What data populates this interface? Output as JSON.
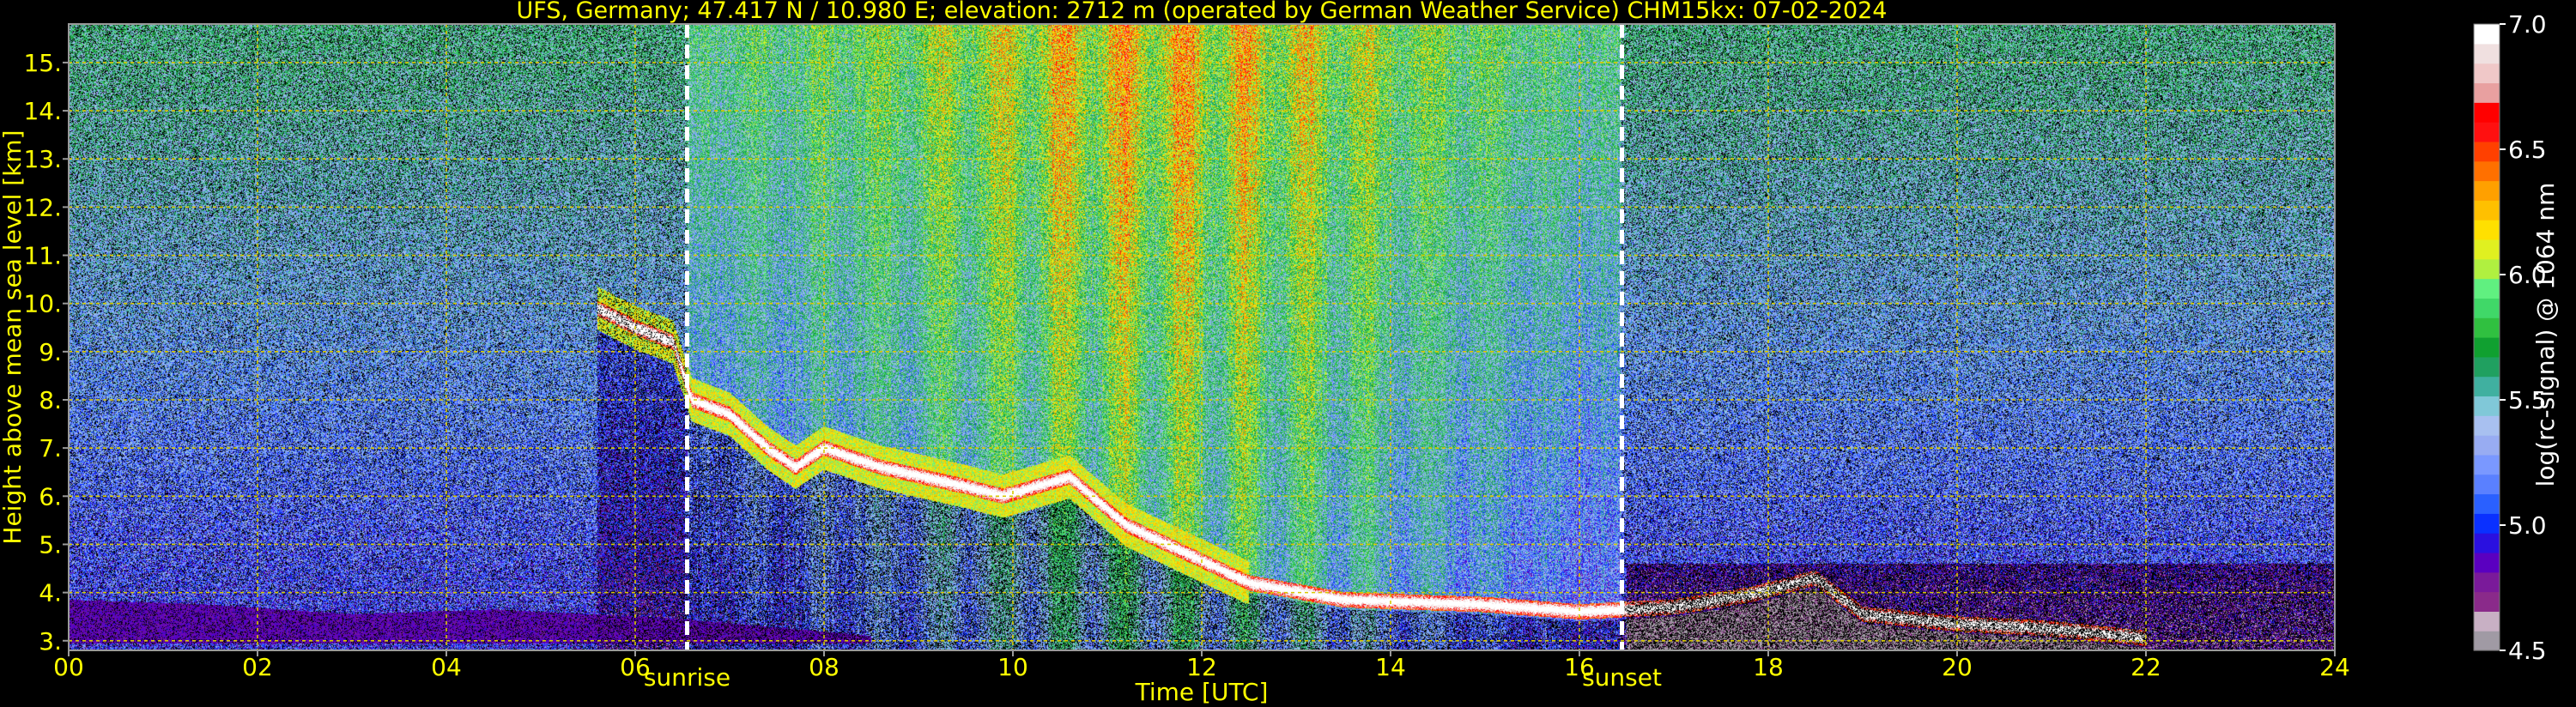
{
  "chart_data": {
    "type": "heatmap",
    "title": "UFS, Germany; 47.417 N / 10.980 E; elevation: 2712 m  (operated by German Weather Service)    CHM15kx: 07-02-2024",
    "xlabel": "Time [UTC]",
    "ylabel": "Height above mean sea level [km]",
    "xlim": [
      0,
      24
    ],
    "ylim": [
      2.8,
      15.8
    ],
    "x_ticks": [
      {
        "value": 0,
        "label": "00"
      },
      {
        "value": 2,
        "label": "02"
      },
      {
        "value": 4,
        "label": "04"
      },
      {
        "value": 6,
        "label": "06"
      },
      {
        "value": 8,
        "label": "08"
      },
      {
        "value": 10,
        "label": "10"
      },
      {
        "value": 12,
        "label": "12"
      },
      {
        "value": 14,
        "label": "14"
      },
      {
        "value": 16,
        "label": "16"
      },
      {
        "value": 18,
        "label": "18"
      },
      {
        "value": 20,
        "label": "20"
      },
      {
        "value": 22,
        "label": "22"
      },
      {
        "value": 24,
        "label": "24"
      }
    ],
    "y_ticks": [
      {
        "value": 3,
        "label": "3."
      },
      {
        "value": 4,
        "label": "4."
      },
      {
        "value": 5,
        "label": "5."
      },
      {
        "value": 6,
        "label": "6."
      },
      {
        "value": 7,
        "label": "7."
      },
      {
        "value": 8,
        "label": "8."
      },
      {
        "value": 9,
        "label": "9."
      },
      {
        "value": 10,
        "label": "10."
      },
      {
        "value": 11,
        "label": "11."
      },
      {
        "value": 12,
        "label": "12."
      },
      {
        "value": 13,
        "label": "13."
      },
      {
        "value": 14,
        "label": "14."
      },
      {
        "value": 15,
        "label": "15."
      }
    ],
    "grid": true,
    "events": [
      {
        "label": "sunrise",
        "time": 6.55
      },
      {
        "label": "sunset",
        "time": 16.45
      }
    ],
    "colorbar": {
      "label": "log(rc-signal) @ 1064 nm",
      "range": [
        4.5,
        7.0
      ],
      "ticks": [
        {
          "value": 4.5,
          "label": "4.5"
        },
        {
          "value": 5.0,
          "label": "5.0"
        },
        {
          "value": 5.5,
          "label": "5.5"
        },
        {
          "value": 6.0,
          "label": "6.0"
        },
        {
          "value": 6.5,
          "label": "6.5"
        },
        {
          "value": 7.0,
          "label": "7.0"
        }
      ],
      "colors": [
        "#a09aa4",
        "#c8b0c4",
        "#8a2a8a",
        "#7a1a9a",
        "#5a00c0",
        "#2a10e0",
        "#0a30ff",
        "#2a60ff",
        "#5a80ff",
        "#7a98ff",
        "#98acf2",
        "#a8c0f0",
        "#80c8d8",
        "#40b0a0",
        "#20a060",
        "#10a030",
        "#30c040",
        "#40d868",
        "#60f080",
        "#b0f040",
        "#e0f020",
        "#ffe000",
        "#ffc000",
        "#ffa000",
        "#ff7000",
        "#ff4000",
        "#ff1010",
        "#ff0000",
        "#e8a0a0",
        "#f0c8c8",
        "#f0e0e0",
        "#ffffff"
      ]
    },
    "features": {
      "aerosol_layer": [
        {
          "t": 0.0,
          "top": 3.85,
          "bottom": 2.9
        },
        {
          "t": 1.5,
          "top": 3.75,
          "bottom": 2.9
        },
        {
          "t": 3.0,
          "top": 3.55,
          "bottom": 2.9
        },
        {
          "t": 4.5,
          "top": 3.65,
          "bottom": 2.9
        },
        {
          "t": 6.5,
          "top": 3.45,
          "bottom": 2.9
        },
        {
          "t": 8.5,
          "top": 3.1,
          "bottom": 2.9
        }
      ],
      "cloud_layer": [
        {
          "t": 5.6,
          "h": 9.9
        },
        {
          "t": 6.0,
          "h": 9.5
        },
        {
          "t": 6.4,
          "h": 9.2
        },
        {
          "t": 6.6,
          "h": 8.0
        },
        {
          "t": 7.0,
          "h": 7.7
        },
        {
          "t": 7.4,
          "h": 7.0
        },
        {
          "t": 7.7,
          "h": 6.6
        },
        {
          "t": 8.0,
          "h": 7.0
        },
        {
          "t": 8.6,
          "h": 6.6
        },
        {
          "t": 9.5,
          "h": 6.2
        },
        {
          "t": 9.9,
          "h": 6.0
        },
        {
          "t": 10.6,
          "h": 6.4
        },
        {
          "t": 11.2,
          "h": 5.4
        },
        {
          "t": 12.5,
          "h": 4.2
        },
        {
          "t": 13.5,
          "h": 3.85
        },
        {
          "t": 15.0,
          "h": 3.75
        },
        {
          "t": 16.0,
          "h": 3.6
        },
        {
          "t": 17.0,
          "h": 3.7
        },
        {
          "t": 17.8,
          "h": 3.95
        },
        {
          "t": 18.5,
          "h": 4.3
        },
        {
          "t": 19.0,
          "h": 3.55
        },
        {
          "t": 20.0,
          "h": 3.35
        },
        {
          "t": 21.0,
          "h": 3.25
        },
        {
          "t": 22.0,
          "h": 3.05
        }
      ]
    }
  }
}
